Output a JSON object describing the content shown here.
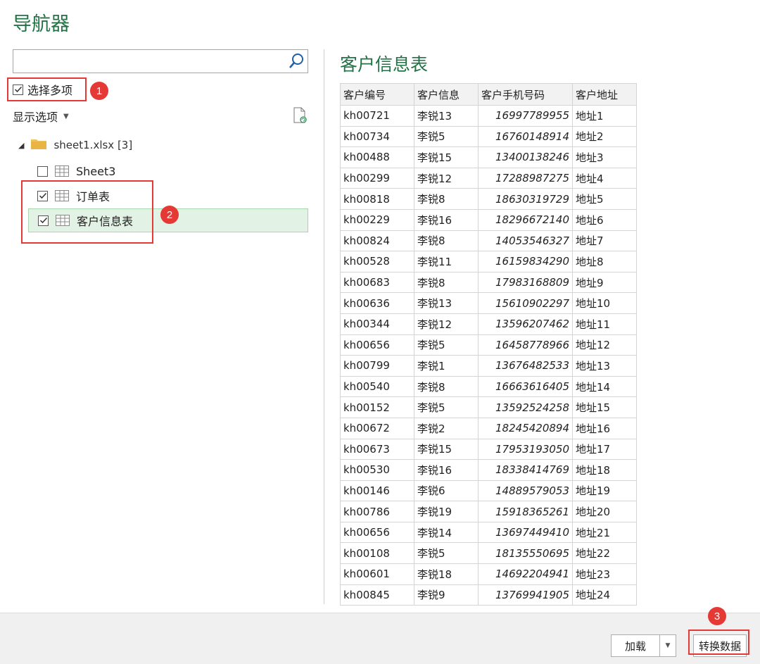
{
  "window": {
    "title": "导航器"
  },
  "search": {
    "placeholder": ""
  },
  "multi_select": {
    "label": "选择多项",
    "checked": true
  },
  "display_options": {
    "label": "显示选项"
  },
  "tree": {
    "file_label": "sheet1.xlsx [3]",
    "items": [
      {
        "label": "Sheet3",
        "checked": false
      },
      {
        "label": "订单表",
        "checked": true
      },
      {
        "label": "客户信息表",
        "checked": true
      }
    ]
  },
  "annotations": [
    "1",
    "2",
    "3"
  ],
  "preview": {
    "title": "客户信息表",
    "columns": [
      "客户编号",
      "客户信息",
      "客户手机号码",
      "客户地址"
    ],
    "rows": [
      [
        "kh00721",
        "李锐13",
        "16997789955",
        "地址1"
      ],
      [
        "kh00734",
        "李锐5",
        "16760148914",
        "地址2"
      ],
      [
        "kh00488",
        "李锐15",
        "13400138246",
        "地址3"
      ],
      [
        "kh00299",
        "李锐12",
        "17288987275",
        "地址4"
      ],
      [
        "kh00818",
        "李锐8",
        "18630319729",
        "地址5"
      ],
      [
        "kh00229",
        "李锐16",
        "18296672140",
        "地址6"
      ],
      [
        "kh00824",
        "李锐8",
        "14053546327",
        "地址7"
      ],
      [
        "kh00528",
        "李锐11",
        "16159834290",
        "地址8"
      ],
      [
        "kh00683",
        "李锐8",
        "17983168809",
        "地址9"
      ],
      [
        "kh00636",
        "李锐13",
        "15610902297",
        "地址10"
      ],
      [
        "kh00344",
        "李锐12",
        "13596207462",
        "地址11"
      ],
      [
        "kh00656",
        "李锐5",
        "16458778966",
        "地址12"
      ],
      [
        "kh00799",
        "李锐1",
        "13676482533",
        "地址13"
      ],
      [
        "kh00540",
        "李锐8",
        "16663616405",
        "地址14"
      ],
      [
        "kh00152",
        "李锐5",
        "13592524258",
        "地址15"
      ],
      [
        "kh00672",
        "李锐2",
        "18245420894",
        "地址16"
      ],
      [
        "kh00673",
        "李锐15",
        "17953193050",
        "地址17"
      ],
      [
        "kh00530",
        "李锐16",
        "18338414769",
        "地址18"
      ],
      [
        "kh00146",
        "李锐6",
        "14889579053",
        "地址19"
      ],
      [
        "kh00786",
        "李锐19",
        "15918365261",
        "地址20"
      ],
      [
        "kh00656",
        "李锐14",
        "13697449410",
        "地址21"
      ],
      [
        "kh00108",
        "李锐5",
        "18135550695",
        "地址22"
      ],
      [
        "kh00601",
        "李锐18",
        "14692204941",
        "地址23"
      ],
      [
        "kh00845",
        "李锐9",
        "13769941905",
        "地址24"
      ]
    ]
  },
  "buttons": {
    "load": "加载",
    "transform": "转换数据"
  },
  "colors": {
    "accent": "#217346",
    "highlight": "#e53935",
    "selected_bg": "#e2f2e4"
  }
}
